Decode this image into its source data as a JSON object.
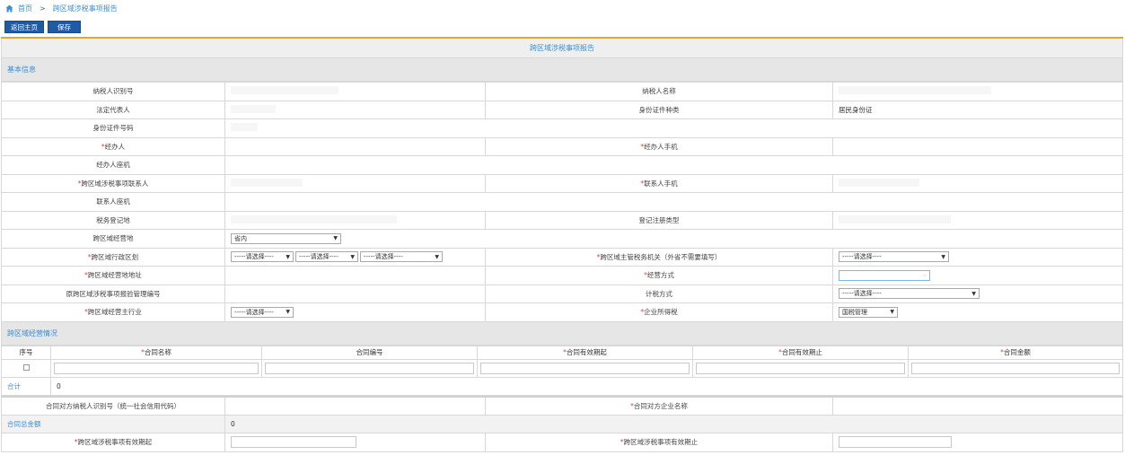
{
  "breadcrumb": {
    "home": "首页",
    "sep": ">",
    "current": "跨区域涉税事项报告"
  },
  "toolbar": {
    "back": "返回主页",
    "save": "保存"
  },
  "title": "跨区域涉税事项报告",
  "section_basic": "基本信息",
  "basic": {
    "taxpayer_id": "纳税人识别号",
    "taxpayer_name": "纳税人名称",
    "legal_rep": "法定代表人",
    "id_type": "身份证件种类",
    "id_type_value": "居民身份证",
    "id_number": "身份证件号码",
    "handler": "经办人",
    "handler_mobile": "经办人手机",
    "handler_phone": "经办人座机",
    "contact": "跨区域涉税事项联系人",
    "contact_mobile": "联系人手机",
    "contact_phone": "联系人座机",
    "tax_reg_addr": "税务登记地",
    "reg_type": "登记注册类型",
    "cross_region": "跨区域经营地",
    "cross_region_value": "省内",
    "admin_division": "跨区域行政区划",
    "select_placeholder": "-----请选择----",
    "tax_authority": "跨区域主管税务机关（外省不需要填写）",
    "biz_addr": "跨区域经营地地址",
    "biz_mode": "经营方式",
    "orig_report_no": "原跨区域涉税事项报验管理编号",
    "tax_method": "计税方式",
    "main_industry": "跨区域经营主行业",
    "income_tax": "企业所得税",
    "income_tax_value": "国税管理"
  },
  "section_ops": "跨区域经营情况",
  "contracts": {
    "col_no": "序号",
    "col_name": "合同名称",
    "col_code": "合同编号",
    "col_start": "合同有效期起",
    "col_end": "合同有效期止",
    "col_amount": "合同金额",
    "total_label": "合计",
    "total_value": "0"
  },
  "bottom": {
    "counterparty_id": "合同对方纳税人识别号（统一社会信用代码）",
    "counterparty_name": "合同对方企业名称",
    "total_amount_label": "合同总金额",
    "total_amount_value": "0",
    "valid_from": "跨区域涉税事项有效期起",
    "valid_to": "跨区域涉税事项有效期止"
  },
  "required_mark": "*"
}
